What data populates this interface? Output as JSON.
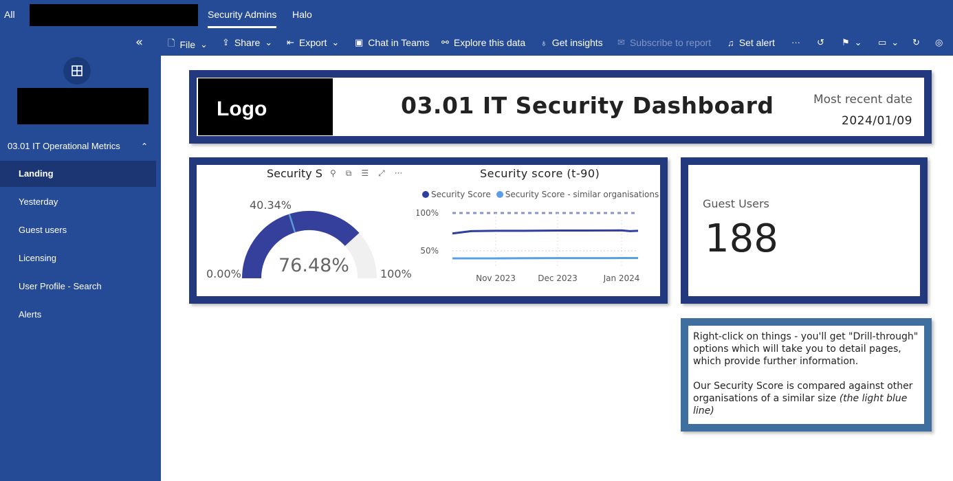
{
  "topnav": {
    "all_label": "All",
    "tabs": [
      {
        "label": "Security Admins"
      },
      {
        "label": "Halo"
      }
    ]
  },
  "sidebar": {
    "section_label": "03.01 IT Operational Metrics",
    "items": [
      {
        "label": "Landing"
      },
      {
        "label": "Yesterday"
      },
      {
        "label": "Guest users"
      },
      {
        "label": "Licensing"
      },
      {
        "label": "User Profile - Search"
      },
      {
        "label": "Alerts"
      }
    ]
  },
  "toolbar": {
    "items": [
      {
        "label": "File",
        "icon": "file-icon"
      },
      {
        "label": "Share",
        "icon": "share-icon"
      },
      {
        "label": "Export",
        "icon": "export-icon"
      },
      {
        "label": "Chat in Teams",
        "icon": "teams-icon"
      },
      {
        "label": "Explore this data",
        "icon": "binoculars-icon"
      },
      {
        "label": "Get insights",
        "icon": "lightbulb-icon"
      },
      {
        "label": "Subscribe to report",
        "icon": "subscribe-icon"
      },
      {
        "label": "Set alert",
        "icon": "bell-icon"
      }
    ]
  },
  "header": {
    "logo_text": "Logo",
    "title": "03.01 IT Security Dashboard",
    "recent_label": "Most recent date",
    "recent_value": "2024/01/09"
  },
  "gauge": {
    "title": "Security S",
    "value_label": "76.48%",
    "target_label": "40.34%",
    "min_label": "0.00%",
    "max_label": "100%",
    "value_fraction": 0.7648,
    "target_fraction": 0.4034,
    "colors": {
      "fill": "#34409c",
      "track": "#f0f0f0",
      "target": "#5b9bd5"
    }
  },
  "line_chart": {
    "title": "Security score (t-90)",
    "legend": [
      "Security Score",
      "Security Score - similar organisations"
    ],
    "yticks": [
      "100%",
      "50%"
    ],
    "xticks": [
      "Nov 2023",
      "Dec 2023",
      "Jan 2024"
    ],
    "colors": {
      "series1": "#2e3f9e",
      "series2": "#5a9ee6"
    }
  },
  "chart_data": {
    "type": "line",
    "title": "Security score (t-90)",
    "x": [
      "2023-10-11",
      "2023-10-20",
      "2023-11-01",
      "2023-11-15",
      "2023-12-01",
      "2023-12-15",
      "2024-01-01",
      "2024-01-05",
      "2024-01-09"
    ],
    "series": [
      {
        "name": "Security Score",
        "values": [
          73,
          76,
          76.5,
          76.5,
          76.8,
          76.8,
          77,
          76,
          76.5
        ]
      },
      {
        "name": "Security Score - similar organisations",
        "values": [
          40,
          40,
          40,
          40.2,
          40.3,
          40.3,
          40.4,
          40.4,
          40.4
        ]
      }
    ],
    "ylim": [
      30,
      100
    ],
    "yticks": [
      "100%",
      "50%"
    ],
    "xticks": [
      "Nov 2023",
      "Dec 2023",
      "Jan 2024"
    ]
  },
  "guest": {
    "label": "Guest Users",
    "value": "188"
  },
  "note": {
    "para1": "Right-click on things - you'll get \"Drill-through\" options which will take you to detail pages, which provide further information.",
    "para2_main": "Our Security Score is compared against other organisations of a similar size ",
    "para2_italic": "(the light blue line)"
  }
}
